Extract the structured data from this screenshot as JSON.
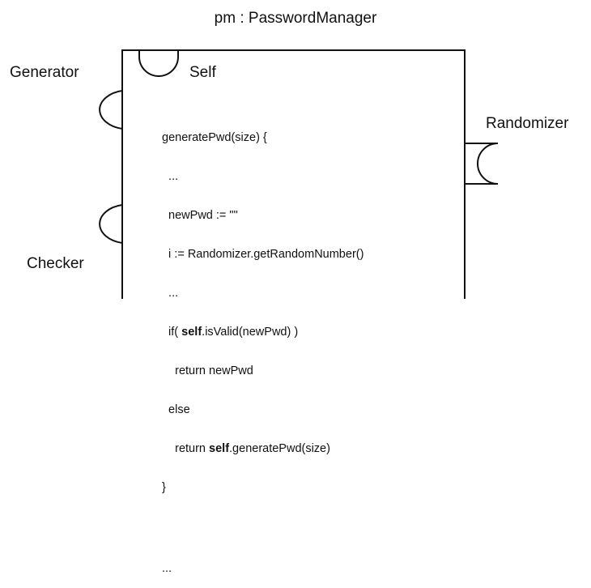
{
  "diagram": {
    "title": "pm : PasswordManager",
    "ports": {
      "self": "Self",
      "generator": "Generator",
      "randomizer": "Randomizer",
      "checker": "Checker"
    },
    "code": {
      "line1": "generatePwd(size) {",
      "line2": "  ...",
      "line3": "  newPwd := \"\"",
      "line4": "  i := Randomizer.getRandomNumber()",
      "line5": "  ...",
      "line6_pre": "  if( ",
      "line6_kw": "self",
      "line6_post": ".isValid(newPwd) )",
      "line7": "    return newPwd",
      "line8": "  else",
      "line9_pre": "    return ",
      "line9_kw": "self",
      "line9_post": ".generatePwd(size)",
      "line10": "}",
      "line11": "...",
      "line12": "..."
    },
    "colors": {
      "stroke": "#111111",
      "background": "#ffffff"
    }
  }
}
